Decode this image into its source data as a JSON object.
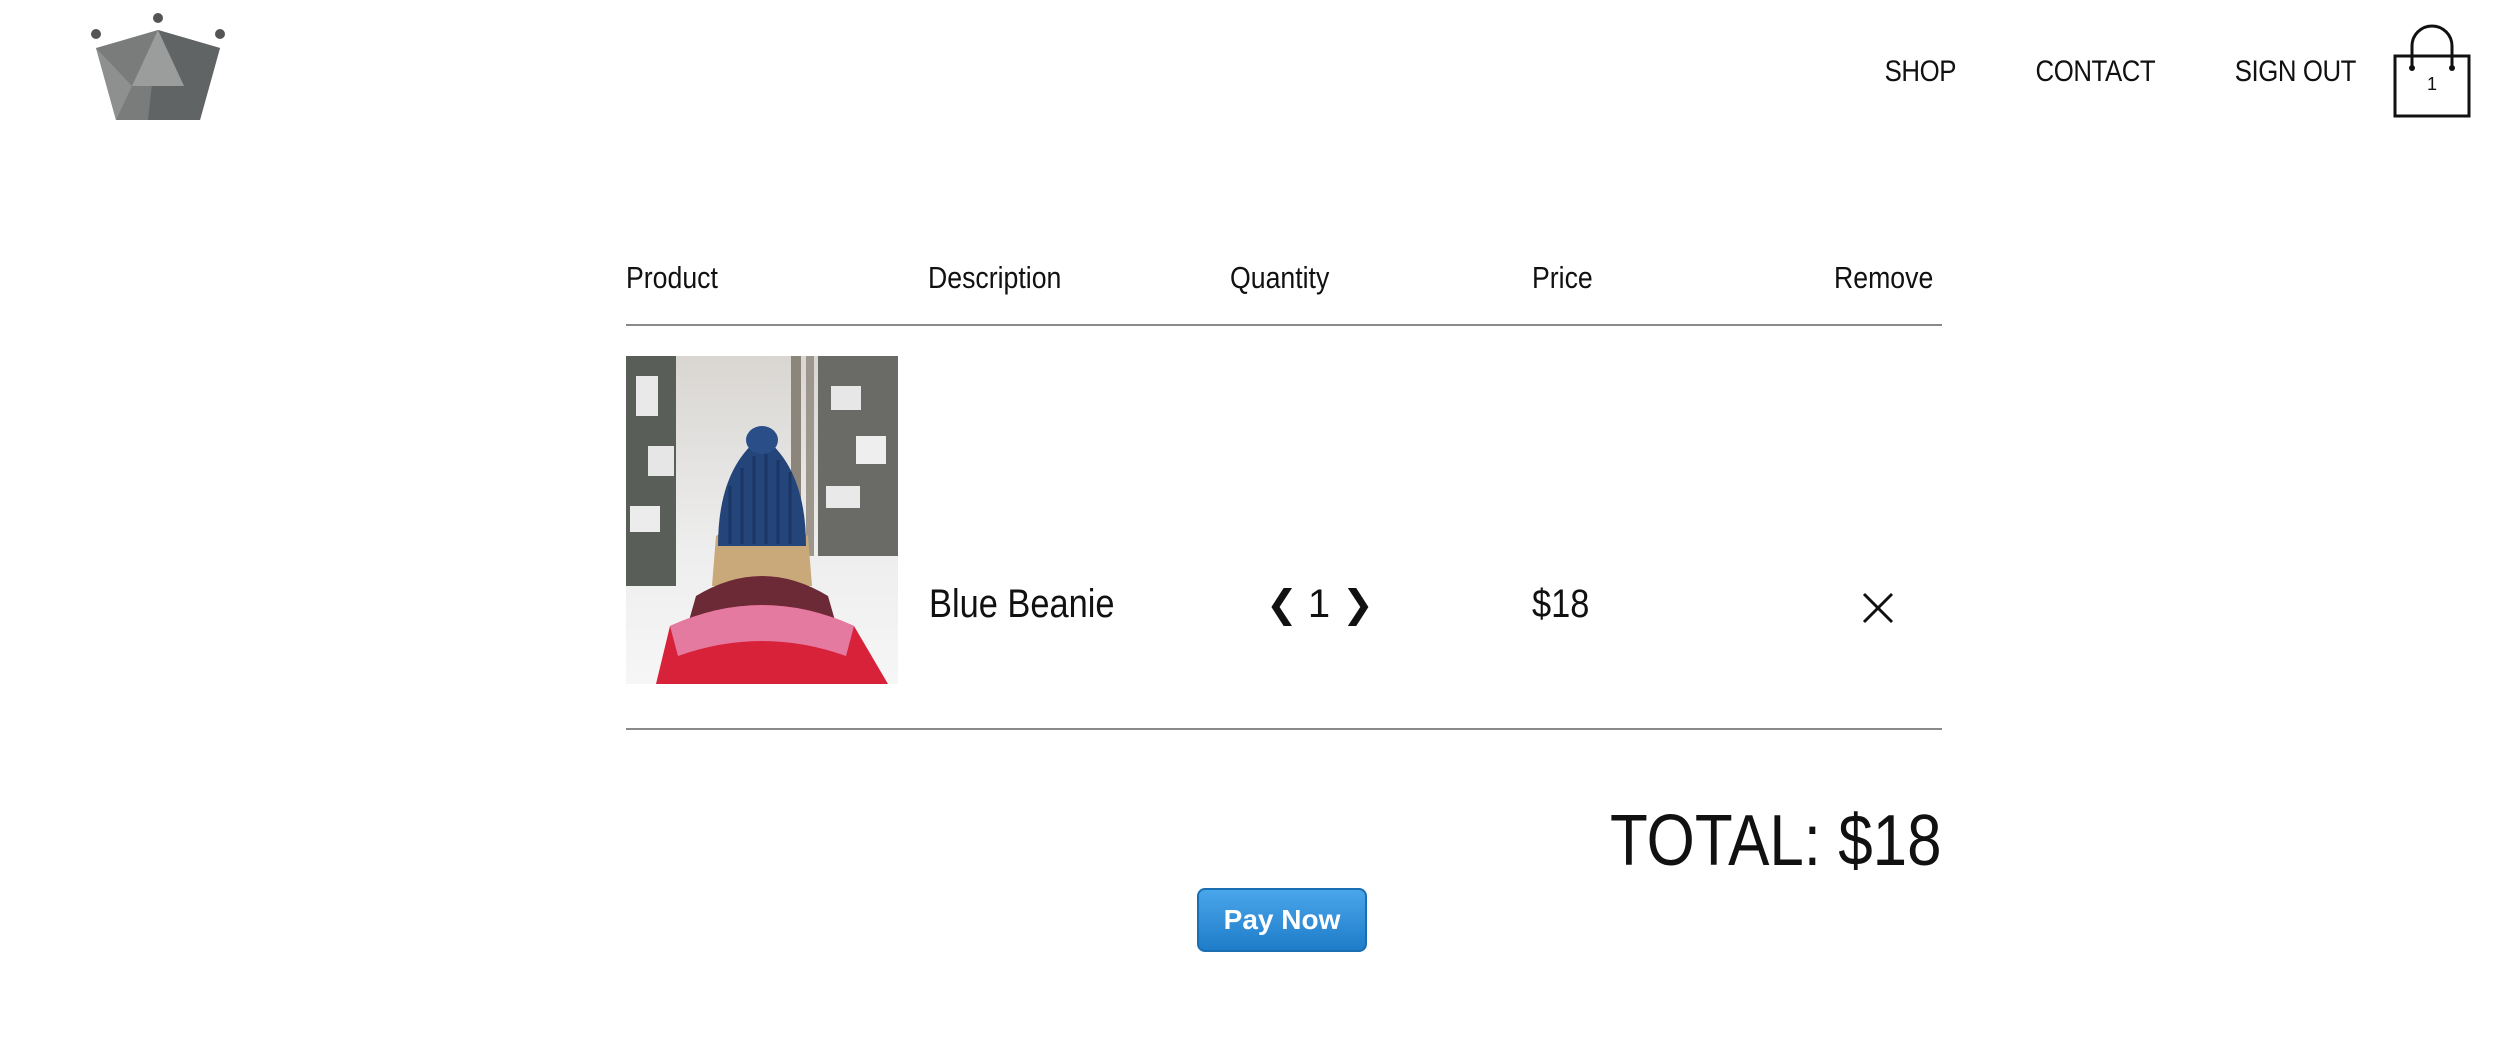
{
  "header": {
    "logo": "crown-logo",
    "nav": [
      {
        "label": "SHOP"
      },
      {
        "label": "CONTACT"
      },
      {
        "label": "SIGN OUT"
      }
    ],
    "cart": {
      "count": "1",
      "icon": "shopping-bag-icon"
    }
  },
  "table": {
    "headers": [
      "Product",
      "Description",
      "Quantity",
      "Price",
      "Remove"
    ],
    "items": [
      {
        "image": "blue-beanie-photo",
        "description": "Blue Beanie",
        "quantity": "1",
        "price": "$18"
      }
    ]
  },
  "total": "TOTAL: $18",
  "pay_button": {
    "label": "Pay Now",
    "color": "#2d8ad6"
  }
}
